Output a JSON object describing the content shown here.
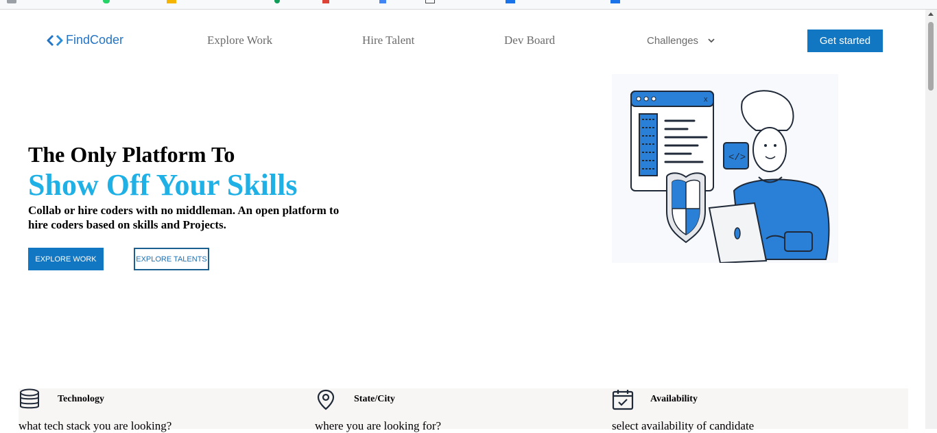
{
  "nav": {
    "logo_text": "FindCoder",
    "links": [
      "Explore Work",
      "Hire Talent",
      "Dev Board"
    ],
    "challenges_label": "Challenges",
    "cta_label": "Get started"
  },
  "hero": {
    "title_line1": "The Only Platform To",
    "title_line2": "Show Off Your Skills",
    "description": "Collab or hire coders with no middleman. An open platform to hire coders based on skills and Projects.",
    "primary_button": "EXPLORE WORK",
    "secondary_button": "EXPLORE TALENTS"
  },
  "filters": [
    {
      "title": "Technology",
      "placeholder": "what tech stack you are looking?",
      "icon": "database-icon"
    },
    {
      "title": "State/City",
      "placeholder": "where you are looking for?",
      "icon": "location-pin-icon"
    },
    {
      "title": "Availability",
      "placeholder": "select availability of candidate",
      "icon": "calendar-check-icon"
    }
  ],
  "colors": {
    "accent": "#1277c3",
    "highlight": "#1fb0e6",
    "logo": "#2474c5",
    "illustration_blue": "#2a7fd6"
  }
}
